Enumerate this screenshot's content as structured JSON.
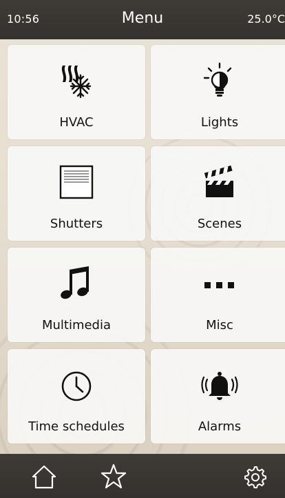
{
  "status": {
    "time": "10:56",
    "title": "Menu",
    "temperature": "25.0°C"
  },
  "tiles": [
    {
      "label": "HVAC",
      "icon": "hvac-icon"
    },
    {
      "label": "Lights",
      "icon": "light-bulb-icon"
    },
    {
      "label": "Shutters",
      "icon": "shutter-icon"
    },
    {
      "label": "Scenes",
      "icon": "clapperboard-icon"
    },
    {
      "label": "Multimedia",
      "icon": "music-note-icon"
    },
    {
      "label": "Misc",
      "icon": "more-dots-icon"
    },
    {
      "label": "Time schedules",
      "icon": "clock-icon"
    },
    {
      "label": "Alarms",
      "icon": "alarm-bell-icon"
    }
  ],
  "nav": {
    "items": [
      {
        "name": "home",
        "icon": "home-icon"
      },
      {
        "name": "favorites",
        "icon": "star-icon"
      },
      {
        "name": "settings",
        "icon": "gear-icon"
      }
    ]
  },
  "colors": {
    "bar_background": "#3a3633",
    "tile_background": "#f7f7f6",
    "text": "#111111"
  }
}
